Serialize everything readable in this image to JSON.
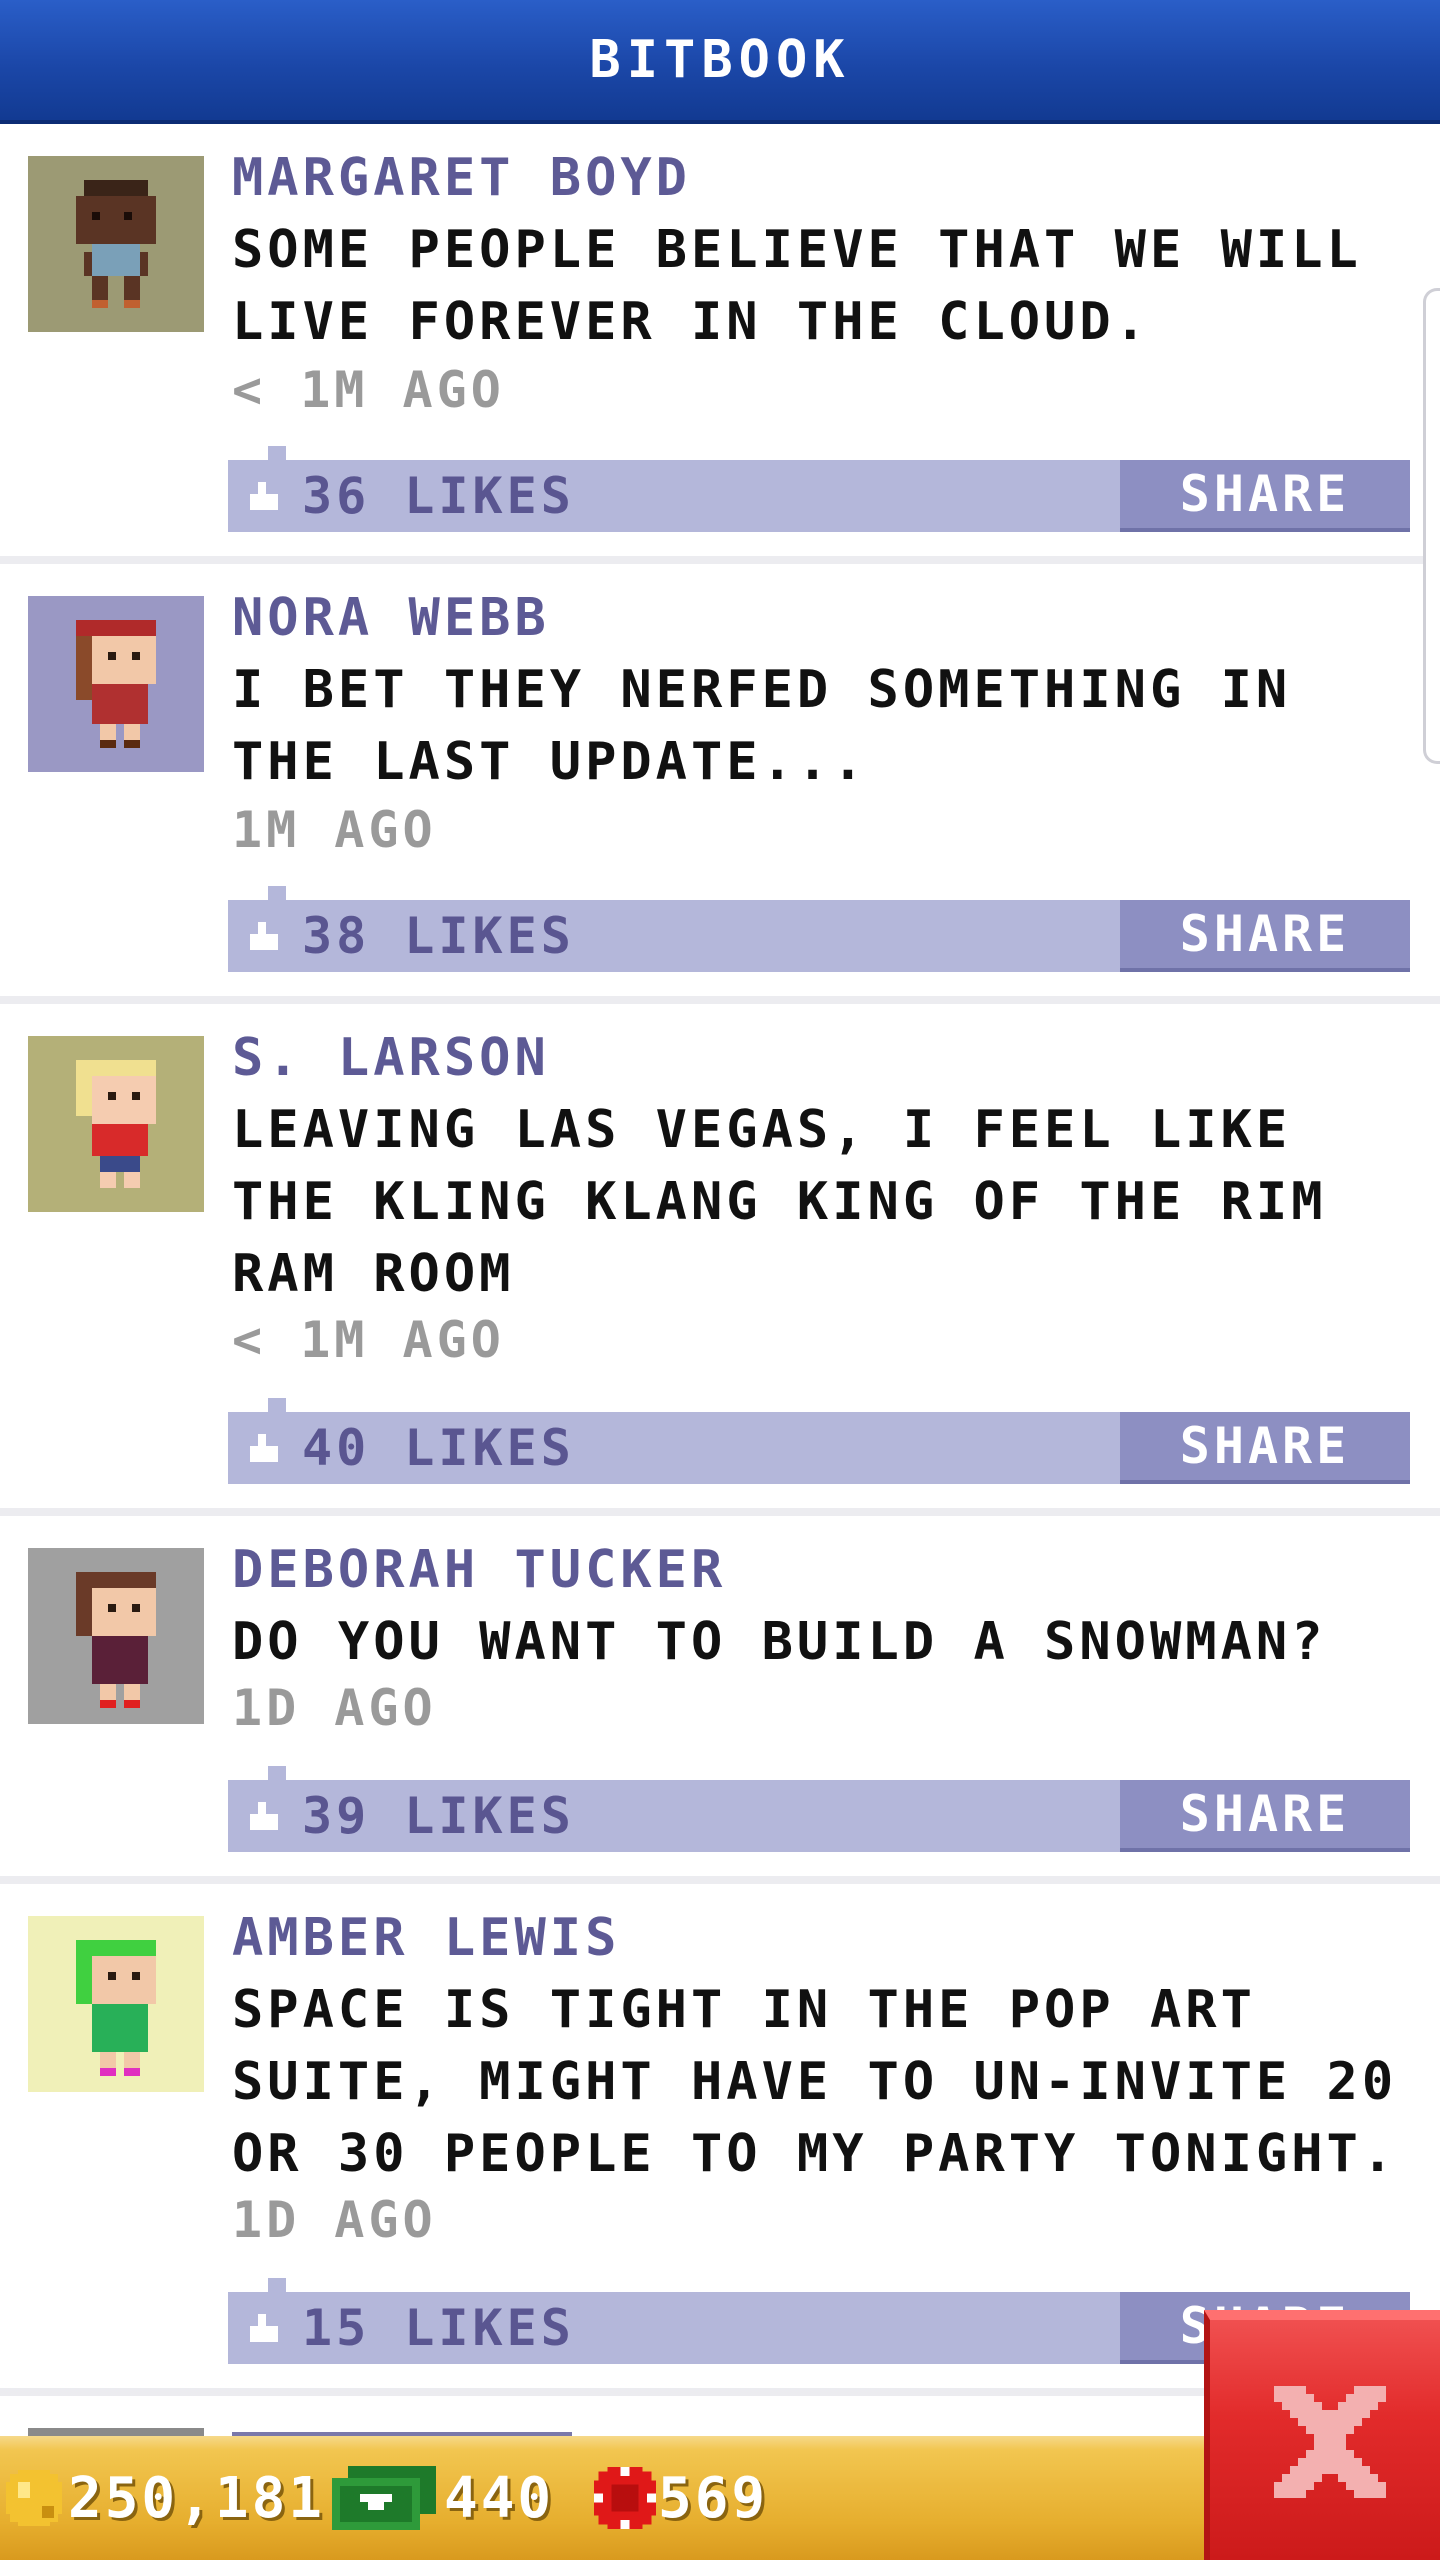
{
  "header": {
    "title": "BITBOOK"
  },
  "posts": [
    {
      "name": "MARGARET BOYD",
      "text": "SOME PEOPLE BELIEVE THAT WE WILL LIVE FOREVER IN THE CLOUD.",
      "time": "< 1M AGO",
      "likes": "36 LIKES",
      "share": "SHARE"
    },
    {
      "name": "NORA WEBB",
      "text": "I BET THEY NERFED SOMETHING IN THE LAST UPDATE...",
      "time": "1M AGO",
      "likes": "38 LIKES",
      "share": "SHARE"
    },
    {
      "name": "S. LARSON",
      "text": "LEAVING LAS VEGAS, I FEEL LIKE THE KLING KLANG KING OF THE RIM RAM ROOM",
      "time": "< 1M AGO",
      "likes": "40 LIKES",
      "share": "SHARE"
    },
    {
      "name": "DEBORAH TUCKER",
      "text": "DO YOU WANT TO BUILD A SNOWMAN?",
      "time": "1D AGO",
      "likes": "39 LIKES",
      "share": "SHARE"
    },
    {
      "name": "AMBER LEWIS",
      "text": "SPACE IS TIGHT IN THE POP ART SUITE, MIGHT HAVE TO UN-INVITE 20 OR 30 PEOPLE TO MY PARTY TONIGHT.",
      "time": "1D AGO",
      "likes": "15 LIKES",
      "share": "SHARE"
    }
  ],
  "status": {
    "coins": "250,181",
    "bux": "440",
    "tokens": "569"
  },
  "colors": {
    "header": "#1b47a8",
    "accent_bar": "#b4b7da",
    "share_button": "#8d8fc2",
    "name": "#5d5a95",
    "bottom_bar": "#f2c650",
    "close_button": "#e22b2b"
  },
  "icons": {
    "like": "thumbs-up-icon",
    "coin": "coin-icon",
    "bux": "bux-bill-icon",
    "token": "token-chip-icon",
    "close": "close-x-icon"
  }
}
